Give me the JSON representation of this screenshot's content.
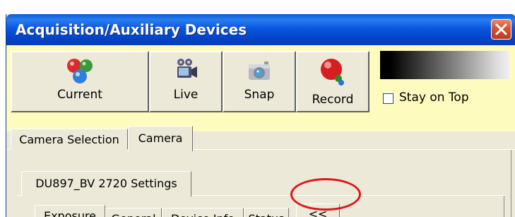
{
  "window": {
    "title": "Acquisition/Auxiliary Devices",
    "close_icon": "close-icon"
  },
  "toolbar": {
    "buttons": [
      {
        "label": "Current",
        "icon": "current-molecule-icon"
      },
      {
        "label": "Live",
        "icon": "live-video-camera-icon"
      },
      {
        "label": "Snap",
        "icon": "snap-camera-icon"
      },
      {
        "label": "Record",
        "icon": "record-ball-icon"
      }
    ],
    "stay_on_top_label": "Stay on Top",
    "stay_on_top_checked": false
  },
  "tabs": {
    "outer": [
      "Camera Selection",
      "Camera"
    ],
    "outer_selected": "Camera",
    "settings_group": "DU897_BV 2720 Settings",
    "inner": [
      "Exposure",
      "General",
      "Device Info",
      "Status"
    ],
    "inner_selected": "Exposure",
    "collapse_button_label": "<<"
  },
  "colors": {
    "titlebar": "#0a55e0",
    "toolbar_background": "#fdfbbe",
    "panel_background": "#ece9d8",
    "highlight_ring": "#e0141b"
  }
}
